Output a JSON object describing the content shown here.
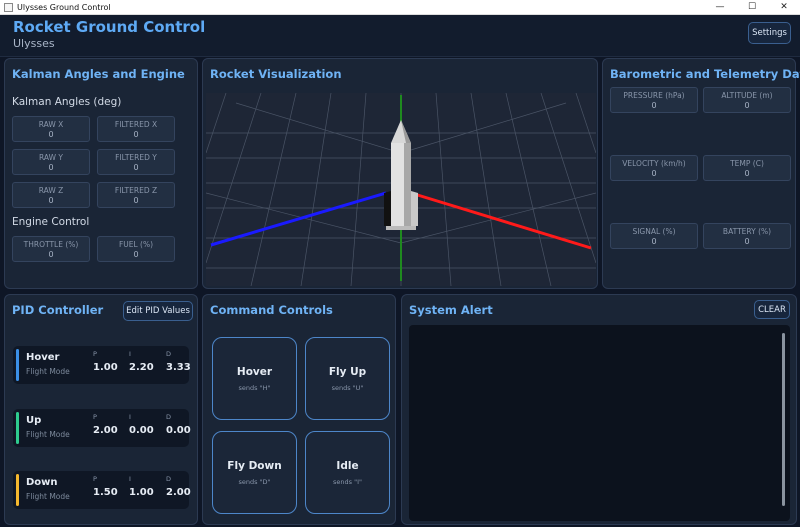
{
  "window": {
    "title": "Ulysses Ground Control",
    "minimize": "—",
    "maximize": "☐",
    "close": "✕"
  },
  "header": {
    "title": "Rocket Ground Control",
    "subtitle": "Ulysses",
    "settings_label": "Settings"
  },
  "kalman_panel": {
    "title": "Kalman Angles and Engine",
    "angles_heading": "Kalman Angles (deg)",
    "stats": [
      {
        "label": "RAW X",
        "value": "0"
      },
      {
        "label": "FILTERED X",
        "value": "0"
      },
      {
        "label": "RAW Y",
        "value": "0"
      },
      {
        "label": "FILTERED Y",
        "value": "0"
      },
      {
        "label": "RAW Z",
        "value": "0"
      },
      {
        "label": "FILTERED Z",
        "value": "0"
      }
    ],
    "engine_heading": "Engine Control",
    "engine_stats": [
      {
        "label": "THROTTLE (%)",
        "value": "0"
      },
      {
        "label": "FUEL (%)",
        "value": "0"
      }
    ]
  },
  "viz_panel": {
    "title": "Rocket Visualization",
    "axis_colors": {
      "x": "#ff1a1a",
      "y": "#1a8a1a",
      "z": "#1a1aff"
    }
  },
  "telemetry_panel": {
    "title": "Barometric and Telemetry Data",
    "stats": [
      {
        "label": "PRESSURE (hPa)",
        "value": "0"
      },
      {
        "label": "ALTITUDE (m)",
        "value": "0"
      },
      {
        "label": "VELOCITY (km/h)",
        "value": "0"
      },
      {
        "label": "TEMP (C)",
        "value": "0"
      },
      {
        "label": "SIGNAL (%)",
        "value": "0"
      },
      {
        "label": "BATTERY (%)",
        "value": "0"
      }
    ]
  },
  "pid_panel": {
    "title": "PID Controller",
    "edit_label": "Edit PID Values",
    "modes": [
      {
        "name": "Hover",
        "sub": "Flight Mode",
        "color": "#3b8fe6",
        "p_label": "P",
        "i_label": "I",
        "d_label": "D",
        "p": "1.00",
        "i": "2.20",
        "d": "3.33"
      },
      {
        "name": "Up",
        "sub": "Flight Mode",
        "color": "#2ecc8f",
        "p_label": "P",
        "i_label": "I",
        "d_label": "D",
        "p": "2.00",
        "i": "0.00",
        "d": "0.00"
      },
      {
        "name": "Down",
        "sub": "Flight Mode",
        "color": "#f5b82e",
        "p_label": "P",
        "i_label": "I",
        "d_label": "D",
        "p": "1.50",
        "i": "1.00",
        "d": "2.00"
      }
    ]
  },
  "command_panel": {
    "title": "Command Controls",
    "commands": [
      {
        "name": "Hover",
        "sub": "sends \"H\""
      },
      {
        "name": "Fly Up",
        "sub": "sends \"U\""
      },
      {
        "name": "Fly Down",
        "sub": "sends \"D\""
      },
      {
        "name": "Idle",
        "sub": "sends \"I\""
      }
    ]
  },
  "alert_panel": {
    "title": "System Alert",
    "clear_label": "CLEAR"
  }
}
